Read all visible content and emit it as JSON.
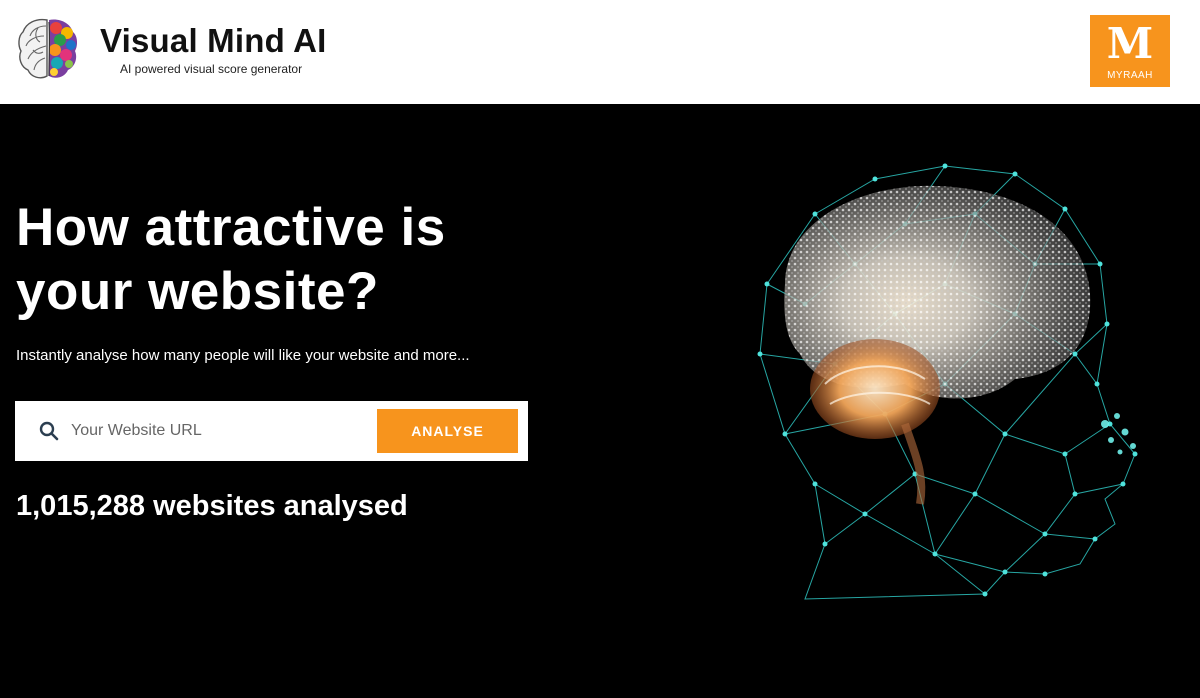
{
  "header": {
    "brand_name": "Visual Mind AI",
    "brand_tagline": "AI powered visual score generator",
    "partner_logo_letter": "M",
    "partner_logo_text": "MYRAAH"
  },
  "hero": {
    "headline": "How attractive is your website?",
    "subhead": "Instantly analyse how many people will like your website and more...",
    "search": {
      "placeholder": "Your Website URL",
      "value": "",
      "button_label": "ANALYSE"
    },
    "count_text": "1,015,288 websites analysed"
  },
  "colors": {
    "accent": "#f7941d",
    "background": "#000000",
    "header_bg": "#ffffff",
    "network": "#3fd6d0"
  },
  "icons": {
    "brand": "colorful-brain-icon",
    "search": "search-icon",
    "hero_image": "brain-network-head-illustration"
  }
}
